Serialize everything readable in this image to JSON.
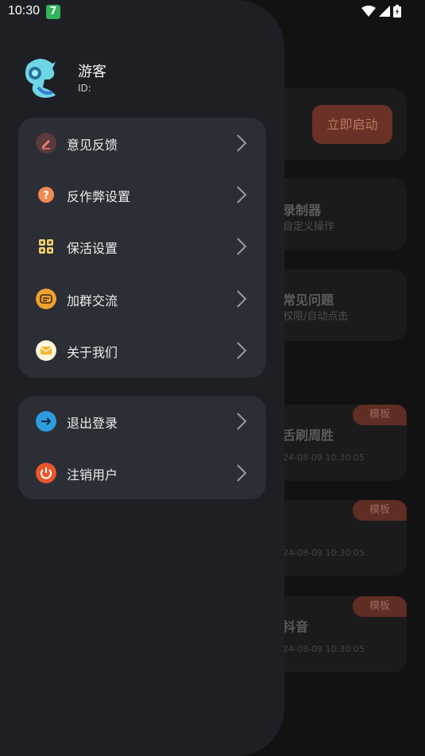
{
  "status_bar": {
    "time": "10:30",
    "badge": "7"
  },
  "drawer": {
    "user": {
      "name": "游客",
      "id_label": "ID:"
    },
    "menu_group_1": [
      {
        "label": "意见反馈",
        "icon": "feedback-icon"
      },
      {
        "label": "反作弊设置",
        "icon": "question-icon"
      },
      {
        "label": "保活设置",
        "icon": "grid-icon"
      },
      {
        "label": "加群交流",
        "icon": "chat-icon"
      },
      {
        "label": "关于我们",
        "icon": "mail-icon"
      }
    ],
    "menu_group_2": [
      {
        "label": "退出登录",
        "icon": "logout-icon"
      },
      {
        "label": "注销用户",
        "icon": "power-icon"
      }
    ]
  },
  "background": {
    "start_button": "立即启动",
    "cards": [
      {
        "title": "录制器",
        "subtitle": "自定义操作"
      },
      {
        "title": "常见问题",
        "subtitle": "权限/自动点击"
      }
    ],
    "scripts": [
      {
        "title": "舌刷周胜",
        "tag": "模板",
        "date": "24-08-09 10:30:05"
      },
      {
        "title": "",
        "tag": "模板",
        "date": "24-08-09 10:30:05"
      },
      {
        "title": "抖音",
        "tag": "模板",
        "date": "24-08-09 10:30:05"
      }
    ]
  },
  "colors": {
    "drawer_bg": "#1d1f24",
    "card_bg": "#2c2e35",
    "accent": "#e85a2c"
  }
}
